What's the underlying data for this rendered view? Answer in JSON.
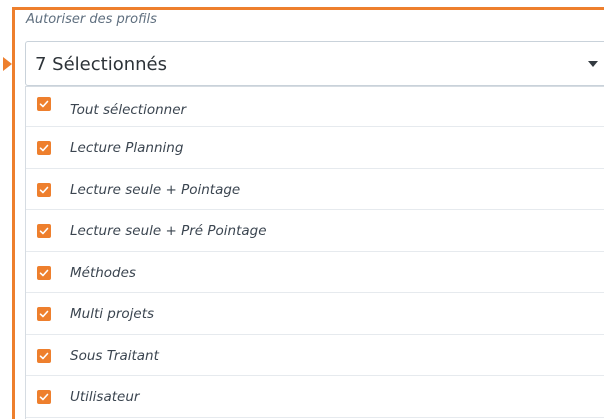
{
  "field": {
    "label": "Autoriser des profils"
  },
  "select": {
    "value": "7 Sélectionnés",
    "caret_icon": "caret-down-icon"
  },
  "options": [
    {
      "label": "Tout sélectionner",
      "checked": true
    },
    {
      "label": "Lecture Planning",
      "checked": true
    },
    {
      "label": "Lecture seule + Pointage",
      "checked": true
    },
    {
      "label": "Lecture seule + Pré Pointage",
      "checked": true
    },
    {
      "label": "Méthodes",
      "checked": true
    },
    {
      "label": "Multi projets",
      "checked": true
    },
    {
      "label": "Sous Traitant",
      "checked": true
    },
    {
      "label": "Utilisateur",
      "checked": true
    }
  ],
  "colors": {
    "highlight": "#ee7f2d",
    "checkbox": "#ee7f2d",
    "border": "#c9d2da"
  }
}
